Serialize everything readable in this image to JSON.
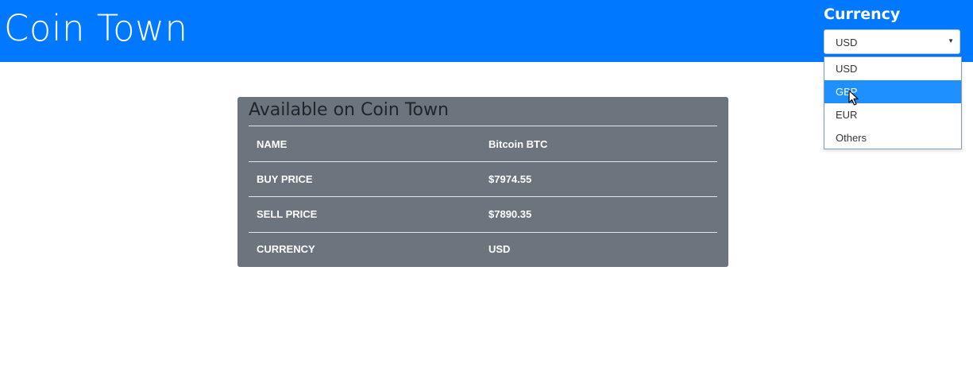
{
  "app": {
    "title": "Coin Town"
  },
  "currency": {
    "label": "Currency",
    "selected": "USD",
    "options": [
      "USD",
      "GBP",
      "EUR",
      "Others"
    ],
    "highlighted": "GBP"
  },
  "panel": {
    "title": "Available on Coin Town",
    "rows": [
      {
        "key": "NAME",
        "value": "Bitcoin BTC"
      },
      {
        "key": "BUY PRICE",
        "value": "$7974.55"
      },
      {
        "key": "SELL PRICE",
        "value": "$7890.35"
      },
      {
        "key": "CURRENCY",
        "value": "USD"
      }
    ]
  },
  "colors": {
    "header": "#0078ff",
    "panel": "#6c757d",
    "highlight": "#1e90ff"
  }
}
